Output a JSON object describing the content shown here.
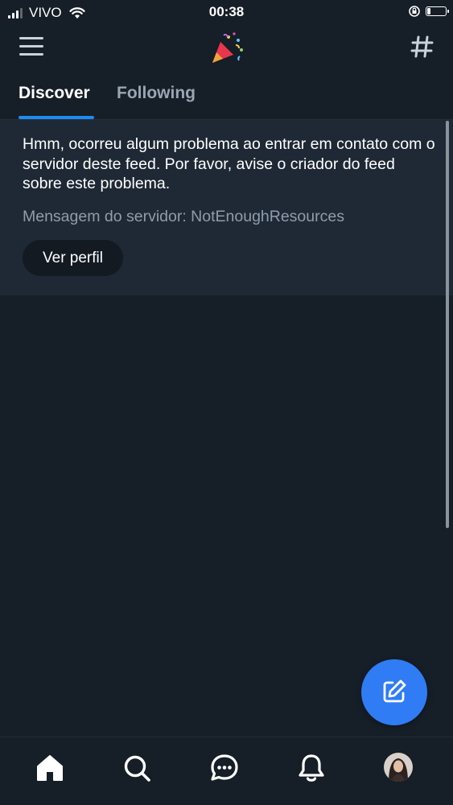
{
  "status_bar": {
    "carrier": "VIVO",
    "time": "00:38",
    "battery_level_percent": 20
  },
  "header": {
    "logo_icon": "party-popper-icon",
    "menu_icon": "hamburger-menu-icon",
    "feeds_icon": "hashtag-icon"
  },
  "tabs": [
    {
      "label": "Discover",
      "active": true
    },
    {
      "label": "Following",
      "active": false
    }
  ],
  "error_card": {
    "message": "Hmm, ocorreu algum problema ao entrar em contato com o servidor deste feed. Por favor, avise o criador do feed sobre este problema.",
    "server_message": "Mensagem do servidor: NotEnoughResources",
    "profile_button_label": "Ver perfil"
  },
  "fab": {
    "icon": "compose-icon"
  },
  "bottom_nav": [
    {
      "icon": "home-icon",
      "active": true
    },
    {
      "icon": "search-icon",
      "active": false
    },
    {
      "icon": "chat-icon",
      "active": false
    },
    {
      "icon": "notifications-bell-icon",
      "active": false
    },
    {
      "icon": "profile-avatar",
      "active": false
    }
  ],
  "colors": {
    "background": "#161e27",
    "card_background": "#1f2935",
    "accent_blue": "#1d8cf0",
    "fab_blue": "#2f7cf5",
    "muted_text": "#8f9cab"
  }
}
